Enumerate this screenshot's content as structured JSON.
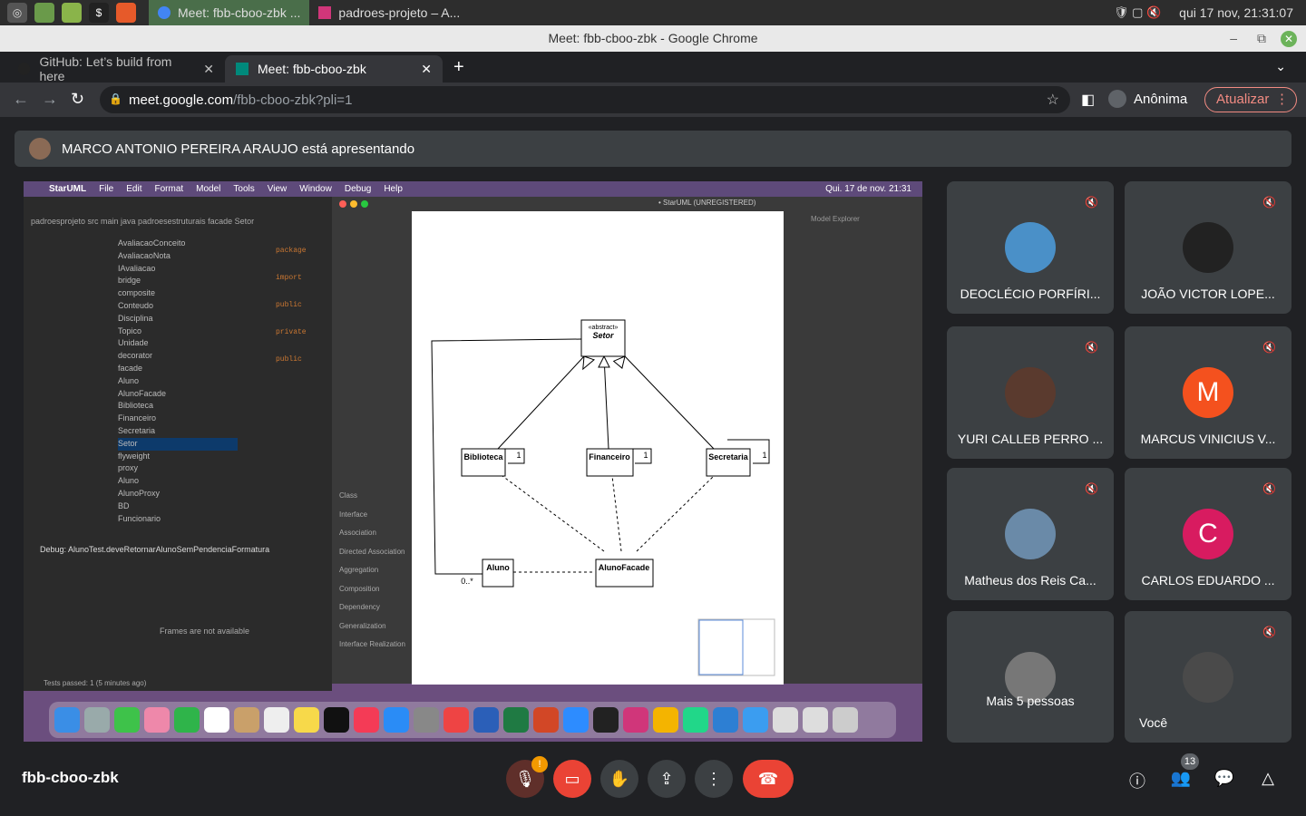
{
  "os": {
    "tasks": [
      {
        "label": "Meet: fbb-cboo-zbk ..."
      },
      {
        "label": "padroes-projeto – A..."
      }
    ],
    "clock": "qui 17 nov, 21:31:07"
  },
  "window_title": "Meet: fbb-cboo-zbk - Google Chrome",
  "tabs": [
    {
      "label": "GitHub: Let’s build from here"
    },
    {
      "label": "Meet: fbb-cboo-zbk"
    }
  ],
  "address": {
    "host": "meet.google.com",
    "path": "/fbb-cboo-zbk?pli=1",
    "profile": "Anônima",
    "update_label": "Atualizar"
  },
  "presenting": "MARCO ANTONIO PEREIRA ARAUJO está apresentando",
  "shared": {
    "mac_menu": [
      "StarUML",
      "File",
      "Edit",
      "Format",
      "Model",
      "Tools",
      "View",
      "Window",
      "Debug",
      "Help"
    ],
    "mac_clock": "Qui. 17 de nov.  21:31",
    "uml_title": "• StarUML (UNREGISTERED)",
    "ide_breadcrumb": "padroesprojeto  src  main  java  padroesestruturais  facade  Setor",
    "ide_tree": [
      "AvaliacaoConceito",
      "AvaliacaoNota",
      "IAvaliacao",
      "bridge",
      "composite",
      "Conteudo",
      "Disciplina",
      "Topico",
      "Unidade",
      "decorator",
      "facade",
      "Aluno",
      "AlunoFacade",
      "Biblioteca",
      "Financeiro",
      "Secretaria",
      "Setor",
      "flyweight",
      "proxy",
      "Aluno",
      "AlunoProxy",
      "BD",
      "Funcionario"
    ],
    "debug_label": "AlunoTest.deveRetornarAlunoSemPendenciaFormatura",
    "frames_msg": "Frames are not available",
    "tests_passed": "Tests passed: 1 (5 minutes ago)",
    "toolbox": [
      "Class",
      "Interface",
      "Association",
      "Directed Association",
      "Aggregation",
      "Composition",
      "Dependency",
      "Generalization",
      "Interface Realization"
    ],
    "diagram": {
      "abstract": "«abstract»",
      "setor": "Setor",
      "classes": [
        "Biblioteca",
        "Financeiro",
        "Secretaria",
        "Aluno",
        "AlunoFacade"
      ],
      "mult_one": "1",
      "mult_many": "0..*"
    },
    "model_explorer": "Model Explorer"
  },
  "participants": [
    {
      "name": "DEOCLÉCIO PORFÍRI...",
      "color": "#4a90c8"
    },
    {
      "name": "JOÃO VICTOR LOPE...",
      "color": "#222222"
    },
    {
      "name": "YURI CALLEB PERRO ...",
      "color": "#5a3a2e"
    },
    {
      "name": "MARCUS VINICIUS V...",
      "initial": "M",
      "color": "#f4511e"
    },
    {
      "name": "Matheus dos Reis Ca...",
      "color": "#6a8aa8"
    },
    {
      "name": "CARLOS EDUARDO ...",
      "initial": "C",
      "color": "#d81b60"
    },
    {
      "name": "Mais 5 pessoas",
      "color": "#777777"
    },
    {
      "name": "Você",
      "color": "#4a4a4a"
    }
  ],
  "meeting_code": "fbb-cboo-zbk",
  "people_count": "13"
}
